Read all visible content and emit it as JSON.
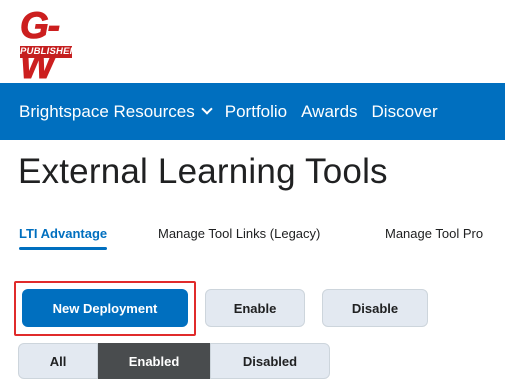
{
  "logo": {
    "top": "G-W",
    "bottom": "PUBLISHER"
  },
  "nav": {
    "items": [
      {
        "label": "Brightspace Resources",
        "has_chevron": true
      },
      {
        "label": "Portfolio"
      },
      {
        "label": "Awards"
      },
      {
        "label": "Discover"
      }
    ],
    "background": "#006fbf"
  },
  "page": {
    "title": "External Learning Tools"
  },
  "tabs": [
    {
      "label": "LTI Advantage",
      "active": true
    },
    {
      "label": "Manage Tool Links (Legacy)"
    },
    {
      "label": "Manage Tool Pro"
    }
  ],
  "actions": {
    "new_deployment": "New Deployment",
    "enable": "Enable",
    "disable": "Disable"
  },
  "filter": {
    "options": [
      "All",
      "Enabled",
      "Disabled"
    ],
    "selected": "Enabled"
  },
  "colors": {
    "accent": "#006fbf",
    "highlight": "#e02b2b",
    "selected_filter": "#494c4e"
  }
}
